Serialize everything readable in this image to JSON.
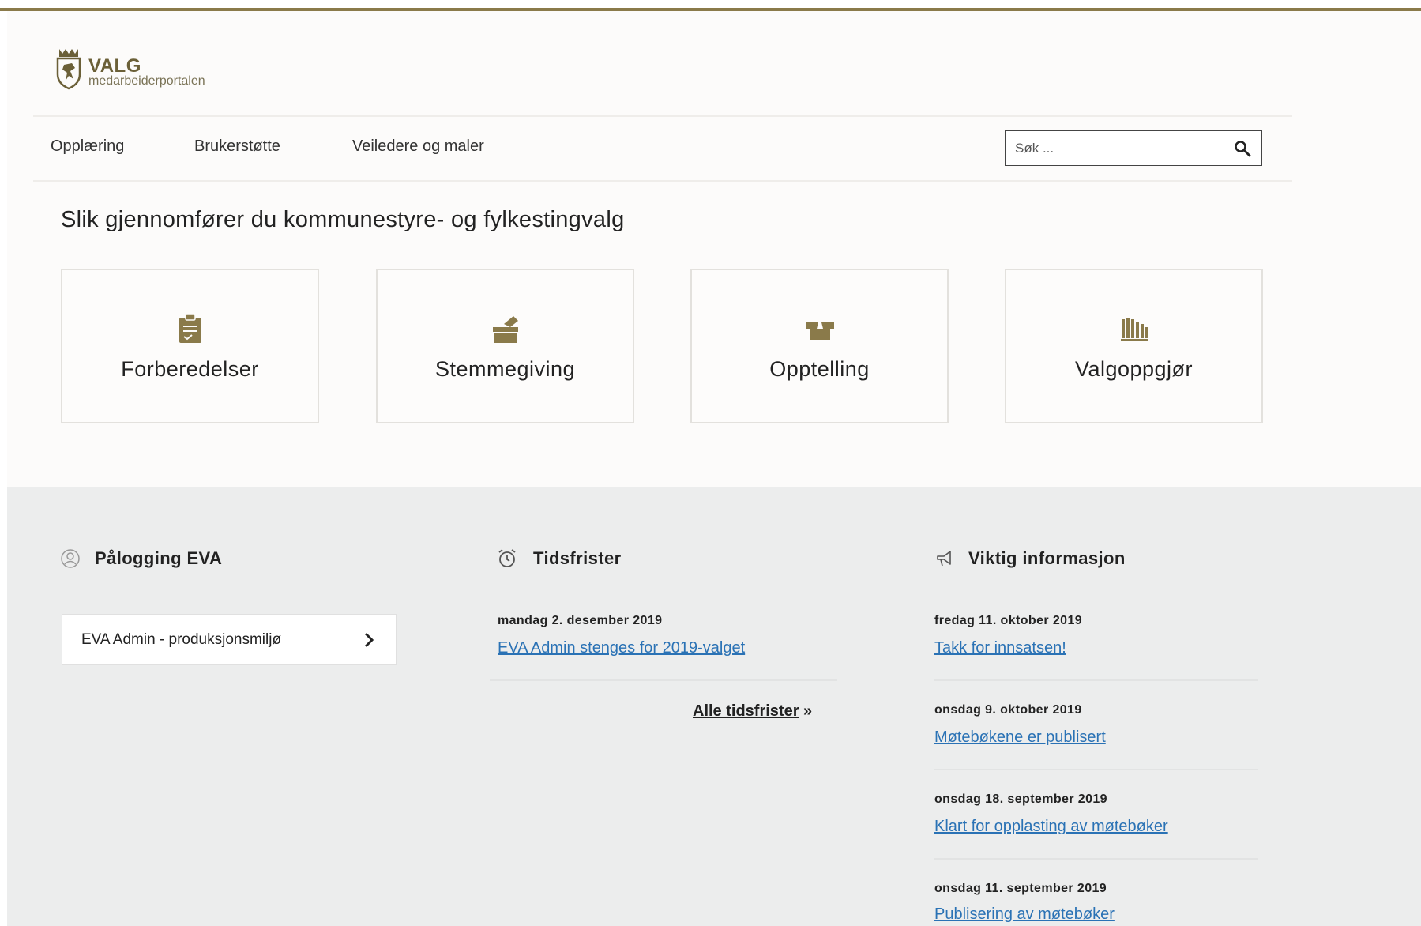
{
  "brand": {
    "title": "VALG",
    "subtitle": "medarbeiderportalen",
    "accent_color": "#8a7a4a",
    "link_color": "#2a72b5"
  },
  "nav": {
    "items": [
      {
        "label": "Opplæring"
      },
      {
        "label": "Brukerstøtte"
      },
      {
        "label": "Veiledere og maler"
      }
    ]
  },
  "search": {
    "placeholder": "Søk ...",
    "icon": "search-icon"
  },
  "main": {
    "title": "Slik gjennomfører du kommunestyre- og fylkestingvalg",
    "cards": [
      {
        "label": "Forberedelser",
        "icon": "clipboard-icon"
      },
      {
        "label": "Stemmegiving",
        "icon": "ballot-box-icon"
      },
      {
        "label": "Opptelling",
        "icon": "open-box-icon"
      },
      {
        "label": "Valgoppgjør",
        "icon": "bar-chart-icon"
      }
    ]
  },
  "login": {
    "heading": "Pålogging EVA",
    "icon": "user-icon",
    "button_label": "EVA Admin - produksjonsmiljø"
  },
  "deadlines": {
    "heading": "Tidsfrister",
    "icon": "alarm-clock-icon",
    "items": [
      {
        "date": "mandag 2. desember 2019",
        "title": "EVA Admin stenges for 2019-valget"
      }
    ],
    "all_label": "Alle tidsfrister",
    "all_suffix": "»"
  },
  "info": {
    "heading": "Viktig informasjon",
    "icon": "megaphone-icon",
    "items": [
      {
        "date": "fredag 11. oktober 2019",
        "title": "Takk for innsatsen!"
      },
      {
        "date": "onsdag 9. oktober 2019",
        "title": "Møtebøkene er publisert"
      },
      {
        "date": "onsdag 18. september 2019",
        "title": "Klart for opplasting av møtebøker"
      },
      {
        "date": "onsdag 11. september 2019",
        "title": "Publisering av møtebøker"
      }
    ]
  }
}
